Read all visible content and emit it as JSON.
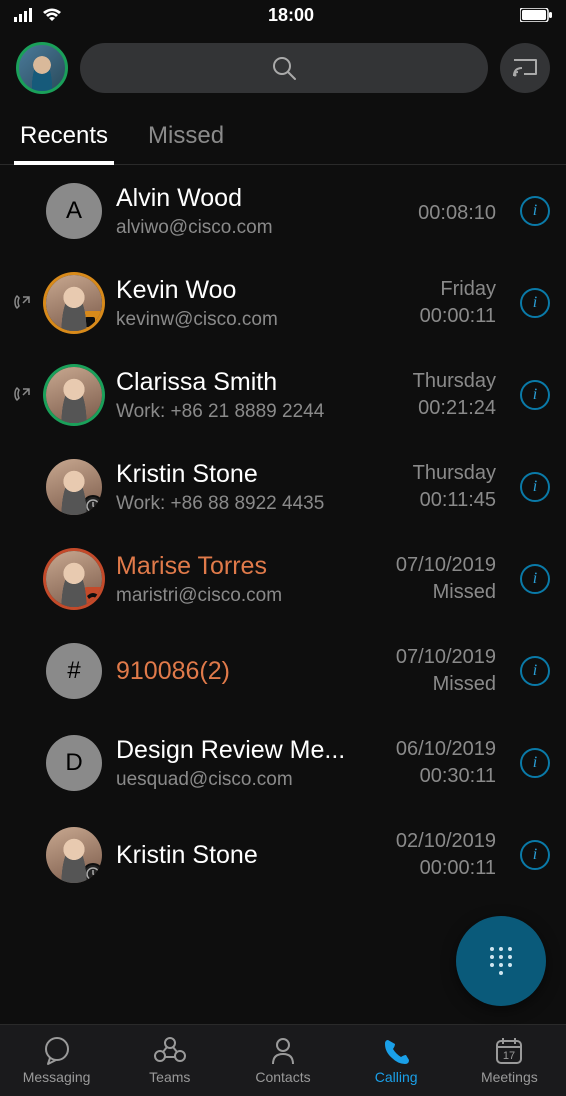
{
  "status": {
    "time": "18:00"
  },
  "search": {
    "placeholder": ""
  },
  "tabs": {
    "recents": "Recents",
    "missed": "Missed",
    "active": "recents"
  },
  "calls": [
    {
      "avatarType": "letter",
      "avatarLetter": "A",
      "name": "Alvin Wood",
      "sub": "alviwo@cisco.com",
      "metaLine1": "",
      "metaLine2": "00:08:10",
      "missed": false
    },
    {
      "avatarType": "photo",
      "ring": "orange",
      "badge": "video",
      "direction": "outgoing",
      "name": "Kevin Woo",
      "sub": "kevinw@cisco.com",
      "metaLine1": "Friday",
      "metaLine2": "00:00:11",
      "missed": false
    },
    {
      "avatarType": "photo",
      "ring": "green",
      "direction": "outgoing",
      "name": "Clarissa Smith",
      "sub": "Work: +86 21 8889 2244",
      "metaLine1": "Thursday",
      "metaLine2": "00:21:24",
      "missed": false
    },
    {
      "avatarType": "photo",
      "badge": "clock",
      "name": "Kristin Stone",
      "sub": "Work: +86 88 8922 4435",
      "metaLine1": "Thursday",
      "metaLine2": "00:11:45",
      "missed": false
    },
    {
      "avatarType": "photo",
      "ring": "red",
      "badge": "missed",
      "name": "Marise Torres",
      "sub": "maristri@cisco.com",
      "metaLine1": "07/10/2019",
      "metaLine2": "Missed",
      "missed": true
    },
    {
      "avatarType": "letter",
      "avatarLetter": "#",
      "name": "910086(2)",
      "sub": "",
      "metaLine1": "07/10/2019",
      "metaLine2": "Missed",
      "missed": true
    },
    {
      "avatarType": "letter",
      "avatarLetter": "D",
      "name": "Design Review Me...",
      "sub": "uesquad@cisco.com",
      "metaLine1": "06/10/2019",
      "metaLine2": "00:30:11",
      "missed": false
    },
    {
      "avatarType": "photo",
      "badge": "clock",
      "name": "Kristin Stone",
      "sub": "",
      "metaLine1": "02/10/2019",
      "metaLine2": "00:00:11",
      "missed": false
    }
  ],
  "nav": {
    "items": [
      {
        "label": "Messaging",
        "icon": "chat"
      },
      {
        "label": "Teams",
        "icon": "teams"
      },
      {
        "label": "Contacts",
        "icon": "contact"
      },
      {
        "label": "Calling",
        "icon": "phone",
        "active": true
      },
      {
        "label": "Meetings",
        "icon": "calendar",
        "badge": "17"
      }
    ]
  }
}
